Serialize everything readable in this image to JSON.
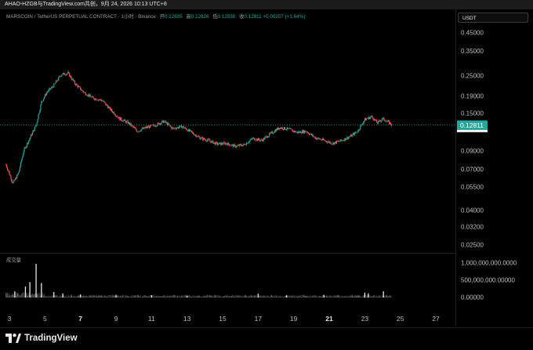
{
  "window": {
    "title": "AHAO-HZGB与TradingView.com共创，9月 24, 2026 10:13 UTC+8"
  },
  "legend": {
    "symbol": "MARSCOIN / TetherUS PERPETUAL CONTRACT · 1小时 · Binance",
    "open_label": "开",
    "open": "0.12605",
    "high_label": "高",
    "high": "0.12826",
    "low_label": "低",
    "low": "0.12530",
    "close_label": "收",
    "close": "0.12811",
    "change": "+0.00207 (+1.64%)"
  },
  "currency_button": "USDT",
  "last_price_tag": "0.12811",
  "volume_title": "成交量",
  "brand": {
    "name": "TradingView",
    "icon": "tradingview-logo-icon"
  },
  "colors": {
    "up": "#26a69a",
    "down": "#ef5350",
    "price_line": "#26a69a",
    "background": "#000000"
  },
  "chart_data": {
    "type": "candlestick",
    "price_axis": {
      "scale": "log",
      "ticks": [
        "0.45000",
        "0.35000",
        "0.25000",
        "0.19000",
        "0.15000",
        "0.09000",
        "0.07000",
        "0.05500",
        "0.04000",
        "0.03200",
        "0.02500"
      ],
      "range": [
        0.021,
        0.52
      ]
    },
    "volume_axis": {
      "ticks": [
        "1,000,000,000.0000",
        "500,000,000.00000",
        "0.00000"
      ]
    },
    "x_axis": {
      "ticks": [
        {
          "label": "3",
          "bold": false
        },
        {
          "label": "5",
          "bold": false
        },
        {
          "label": "7",
          "bold": true
        },
        {
          "label": "9",
          "bold": false
        },
        {
          "label": "11",
          "bold": false
        },
        {
          "label": "13",
          "bold": false
        },
        {
          "label": "15",
          "bold": false
        },
        {
          "label": "17",
          "bold": false
        },
        {
          "label": "19",
          "bold": false
        },
        {
          "label": "21",
          "bold": true
        },
        {
          "label": "23",
          "bold": false
        },
        {
          "label": "25",
          "bold": false
        },
        {
          "label": "27",
          "bold": false
        }
      ]
    },
    "price_path": [
      [
        2.8,
        0.075
      ],
      [
        3.2,
        0.058
      ],
      [
        3.5,
        0.066
      ],
      [
        3.8,
        0.09
      ],
      [
        4.2,
        0.11
      ],
      [
        4.5,
        0.128
      ],
      [
        4.8,
        0.175
      ],
      [
        5.1,
        0.2
      ],
      [
        5.5,
        0.22
      ],
      [
        5.9,
        0.255
      ],
      [
        6.3,
        0.26
      ],
      [
        6.7,
        0.225
      ],
      [
        7.2,
        0.2
      ],
      [
        7.7,
        0.185
      ],
      [
        8.2,
        0.18
      ],
      [
        8.7,
        0.158
      ],
      [
        9.2,
        0.14
      ],
      [
        9.7,
        0.132
      ],
      [
        10.2,
        0.118
      ],
      [
        10.7,
        0.124
      ],
      [
        11.2,
        0.128
      ],
      [
        11.7,
        0.135
      ],
      [
        12.2,
        0.122
      ],
      [
        12.7,
        0.126
      ],
      [
        13.2,
        0.117
      ],
      [
        13.7,
        0.108
      ],
      [
        14.2,
        0.104
      ],
      [
        14.7,
        0.099
      ],
      [
        15.2,
        0.1
      ],
      [
        15.7,
        0.096
      ],
      [
        16.2,
        0.098
      ],
      [
        16.7,
        0.107
      ],
      [
        17.2,
        0.104
      ],
      [
        17.7,
        0.114
      ],
      [
        18.2,
        0.124
      ],
      [
        18.7,
        0.121
      ],
      [
        19.2,
        0.116
      ],
      [
        19.7,
        0.118
      ],
      [
        20.2,
        0.108
      ],
      [
        20.7,
        0.104
      ],
      [
        21.2,
        0.1
      ],
      [
        21.7,
        0.104
      ],
      [
        22.2,
        0.11
      ],
      [
        22.6,
        0.118
      ],
      [
        23.0,
        0.138
      ],
      [
        23.4,
        0.144
      ],
      [
        23.7,
        0.132
      ],
      [
        24.0,
        0.14
      ],
      [
        24.3,
        0.134
      ],
      [
        24.55,
        0.128
      ]
    ],
    "volume_spikes": [
      {
        "x": 3.3,
        "v": 180000000
      },
      {
        "x": 3.9,
        "v": 320000000
      },
      {
        "x": 4.15,
        "v": 450000000
      },
      {
        "x": 4.5,
        "v": 980000000
      },
      {
        "x": 4.8,
        "v": 420000000
      },
      {
        "x": 5.5,
        "v": 160000000
      },
      {
        "x": 6.0,
        "v": 120000000
      },
      {
        "x": 7.0,
        "v": 90000000
      },
      {
        "x": 9.0,
        "v": 80000000
      },
      {
        "x": 11.0,
        "v": 70000000
      },
      {
        "x": 13.0,
        "v": 60000000
      },
      {
        "x": 17.0,
        "v": 110000000
      },
      {
        "x": 18.6,
        "v": 70000000
      },
      {
        "x": 20.7,
        "v": 75000000
      },
      {
        "x": 23.0,
        "v": 140000000
      },
      {
        "x": 23.2,
        "v": 120000000
      },
      {
        "x": 24.05,
        "v": 180000000
      }
    ]
  }
}
